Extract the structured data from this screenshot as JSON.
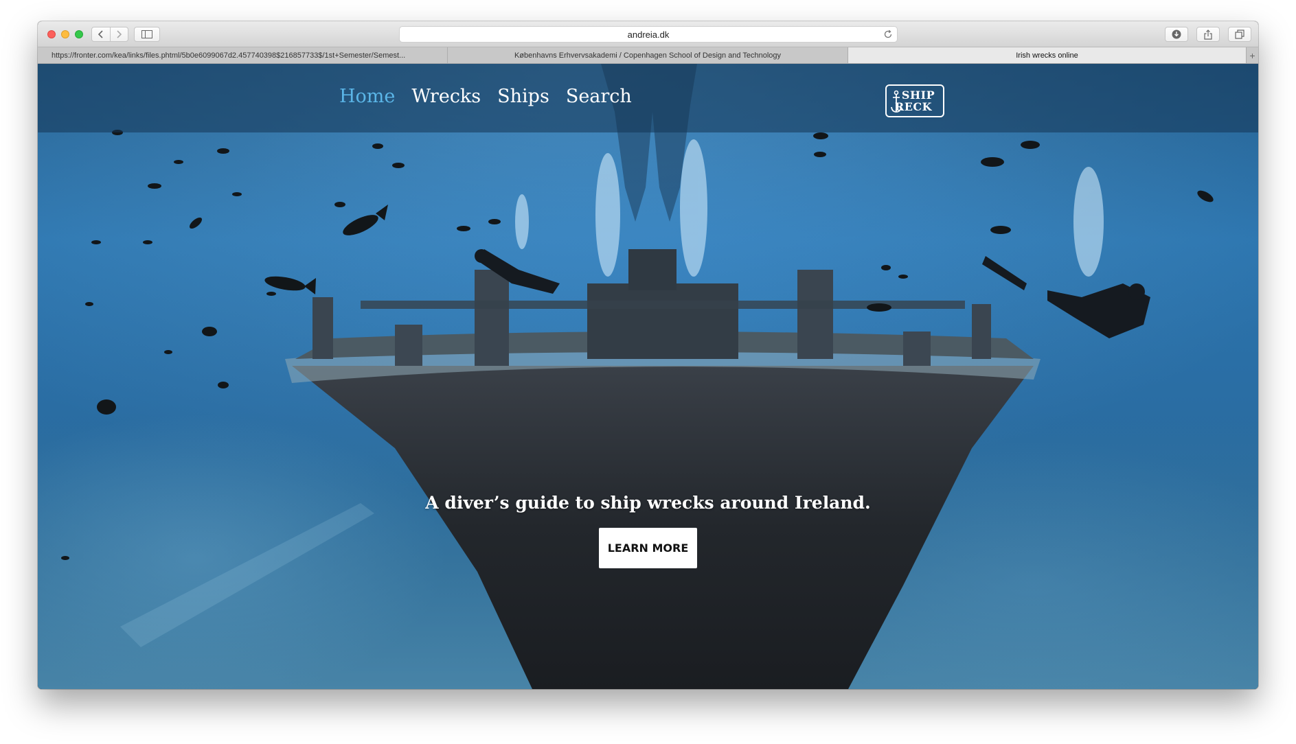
{
  "browser": {
    "address": "andreia.dk",
    "tabs": [
      {
        "label": "https://fronter.com/kea/links/files.phtml/5b0e6099067d2.457740398$216857733$/1st+Semester/Semest..."
      },
      {
        "label": "Københavns Erhvervsakademi / Copenhagen School of Design and Technology"
      },
      {
        "label": "Irish wrecks online"
      }
    ]
  },
  "site": {
    "nav": [
      {
        "label": "Home",
        "active": true
      },
      {
        "label": "Wrecks",
        "active": false
      },
      {
        "label": "Ships",
        "active": false
      },
      {
        "label": "Search",
        "active": false
      }
    ],
    "logo": {
      "line1": "SHIP",
      "line2": "RECK"
    },
    "hero": {
      "tagline": "A diver’s guide to ship wrecks around Ireland.",
      "button_label": "LEARN MORE"
    }
  },
  "colors": {
    "nav_active": "#5bb6e8",
    "navbar_bg": "rgba(20,52,84,0.55)",
    "water": "#2b74ae"
  },
  "icons": [
    "back-icon",
    "forward-icon",
    "sidebar-icon",
    "reload-icon",
    "download-icon",
    "share-icon",
    "tabs-icon",
    "anchor-icon"
  ]
}
